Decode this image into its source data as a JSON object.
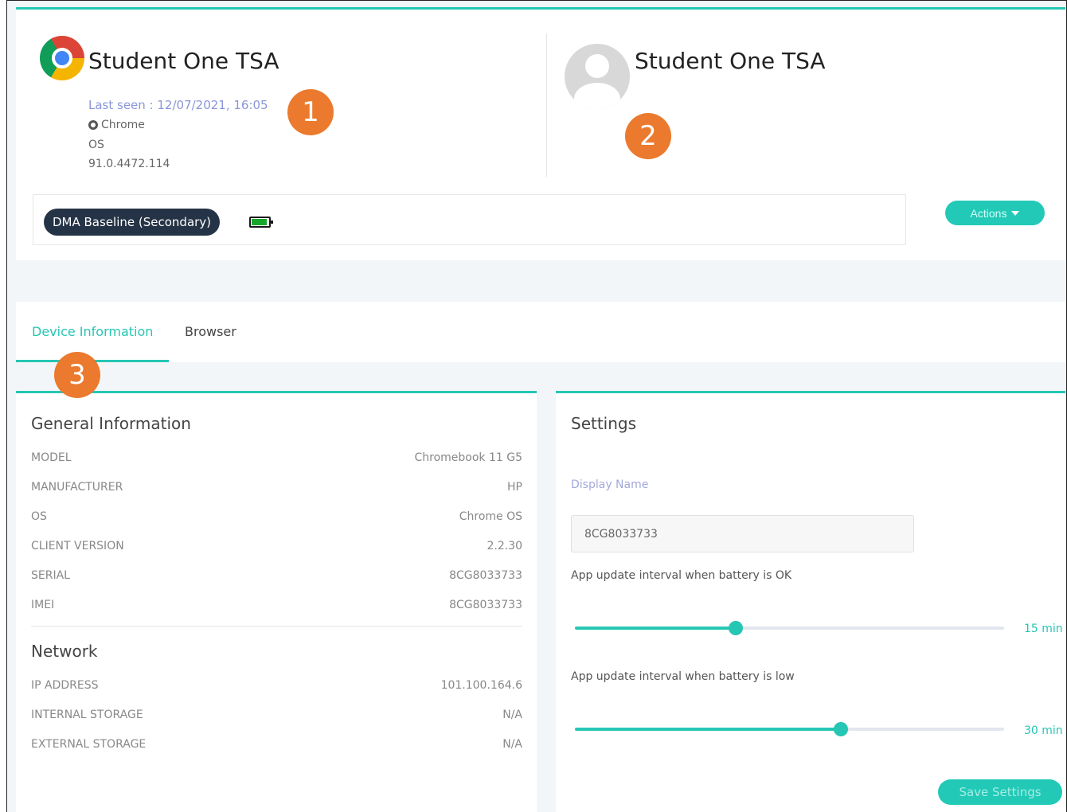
{
  "device": {
    "title": "Student One TSA",
    "last_seen": "Last seen : 12/07/2021, 16:05",
    "browser": "Chrome",
    "os": "OS",
    "version": "91.0.4472.114"
  },
  "user": {
    "title": "Student One TSA"
  },
  "badges": {
    "one": "1",
    "two": "2",
    "three": "3"
  },
  "profile": {
    "pill": "DMA Baseline (Secondary)",
    "battery_icon": "battery-full-icon",
    "actions_label": "Actions"
  },
  "tabs": [
    {
      "label": "Device Information",
      "active": true
    },
    {
      "label": "Browser",
      "active": false
    }
  ],
  "general": {
    "title": "General Information",
    "rows": [
      {
        "label": "MODEL",
        "value": "Chromebook 11 G5"
      },
      {
        "label": "MANUFACTURER",
        "value": "HP"
      },
      {
        "label": "OS",
        "value": "Chrome OS"
      },
      {
        "label": "CLIENT VERSION",
        "value": "2.2.30"
      },
      {
        "label": "SERIAL",
        "value": "8CG8033733"
      },
      {
        "label": "IMEI",
        "value": "8CG8033733"
      }
    ]
  },
  "network": {
    "title": "Network",
    "rows": [
      {
        "label": "IP ADDRESS",
        "value": "101.100.164.6"
      },
      {
        "label": "INTERNAL STORAGE",
        "value": "N/A"
      },
      {
        "label": "EXTERNAL STORAGE",
        "value": "N/A"
      }
    ]
  },
  "settings": {
    "title": "Settings",
    "display_name_label": "Display Name",
    "display_name_value": "8CG8033733",
    "slider_ok": {
      "label": "App update interval when battery is OK",
      "value": "15 min",
      "level_percent": 37.5
    },
    "slider_low": {
      "label": "App update interval when battery is low",
      "value": "30 min",
      "level_percent": 62
    },
    "save_label": "Save Settings"
  },
  "colors": {
    "accent": "#26c6b4",
    "badge": "#eb7a2e",
    "pill": "#253346"
  }
}
